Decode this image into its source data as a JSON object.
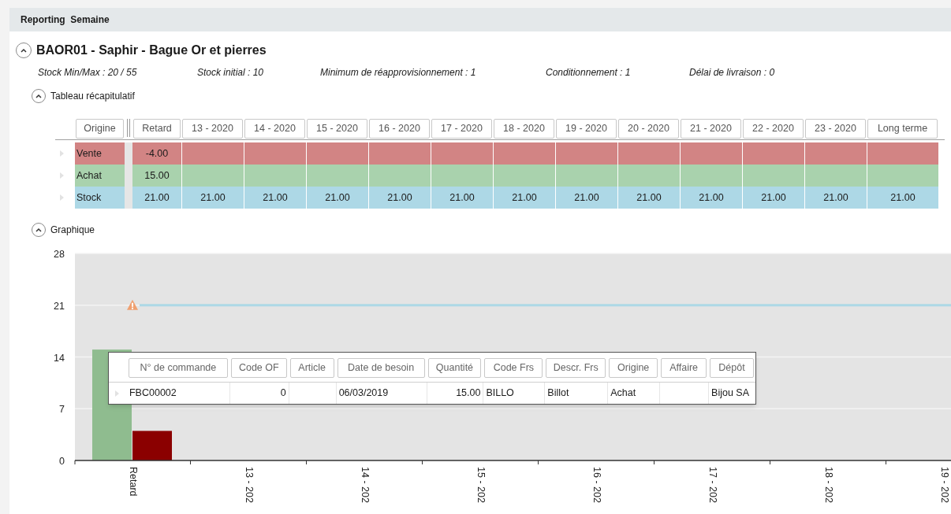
{
  "header": {
    "title": "Reporting  Semaine"
  },
  "product": {
    "title": "BAOR01 - Saphir - Bague Or et pierres",
    "expanded": true
  },
  "info": [
    "Stock Min/Max : 20 / 55",
    "Stock initial : 10",
    "Minimum de réapprovisionnement : 1",
    "Conditionnement : 1",
    "Délai de livraison : 0"
  ],
  "summary": {
    "label": "Tableau récapitulatif",
    "expanded": true,
    "columns": [
      "Origine",
      "Retard",
      "13 - 2020",
      "14 - 2020",
      "15 - 2020",
      "16 - 2020",
      "17 - 2020",
      "18 - 2020",
      "19 - 2020",
      "20 - 2020",
      "21 - 2020",
      "22 - 2020",
      "23 - 2020",
      "Long terme"
    ],
    "rows": [
      {
        "origin": "Vente",
        "color": "#d28484",
        "values": [
          "-4.00"
        ]
      },
      {
        "origin": "Achat",
        "color": "#a9d2ad",
        "values": [
          "15.00"
        ]
      },
      {
        "origin": "Stock",
        "color": "#add8e6",
        "values": [
          "21.00",
          "21.00",
          "21.00",
          "21.00",
          "21.00",
          "21.00",
          "21.00",
          "21.00",
          "21.00",
          "21.00",
          "21.00",
          "21.00",
          "21.00"
        ]
      }
    ]
  },
  "graph": {
    "label": "Graphique",
    "expanded": true,
    "chart_data": {
      "type": "bar",
      "categories": [
        "Retard",
        "13 - 202",
        "14 - 202",
        "15 - 202",
        "16 - 202",
        "17 - 202",
        "18 - 202",
        "19 - 202"
      ],
      "ylim": [
        0,
        28
      ],
      "yticks": [
        0,
        7,
        14,
        21,
        28
      ],
      "grid": true,
      "series": [
        {
          "color": "#8fbc8f",
          "values": [
            15,
            null,
            null,
            null,
            null,
            null,
            null,
            null
          ]
        },
        {
          "color": "#8b0000",
          "values": [
            4,
            null,
            null,
            null,
            null,
            null,
            null,
            null
          ]
        }
      ],
      "ref_lines": [
        {
          "axis": "y",
          "value": 21,
          "color": "#add8e6"
        }
      ]
    },
    "popup": {
      "columns": [
        {
          "label": "N° de commande",
          "kind": "text"
        },
        {
          "label": "Code OF",
          "kind": "number"
        },
        {
          "label": "Article",
          "kind": "text"
        },
        {
          "label": "Date de besoin",
          "kind": "text"
        },
        {
          "label": "Quantité",
          "kind": "number"
        },
        {
          "label": "Code Frs",
          "kind": "text"
        },
        {
          "label": "Descr. Frs",
          "kind": "text"
        },
        {
          "label": "Origine",
          "kind": "text"
        },
        {
          "label": "Affaire",
          "kind": "text"
        },
        {
          "label": "Dépôt",
          "kind": "text"
        }
      ],
      "rows": [
        {
          "order_number": "FBC00002",
          "of_code": "0",
          "need_date": "06/03/2019",
          "quantity": "15.00",
          "supplier_code": "BILLO",
          "supplier_descr": "Billot",
          "origin": "Achat",
          "depot": "Bijou SA"
        }
      ]
    }
  }
}
